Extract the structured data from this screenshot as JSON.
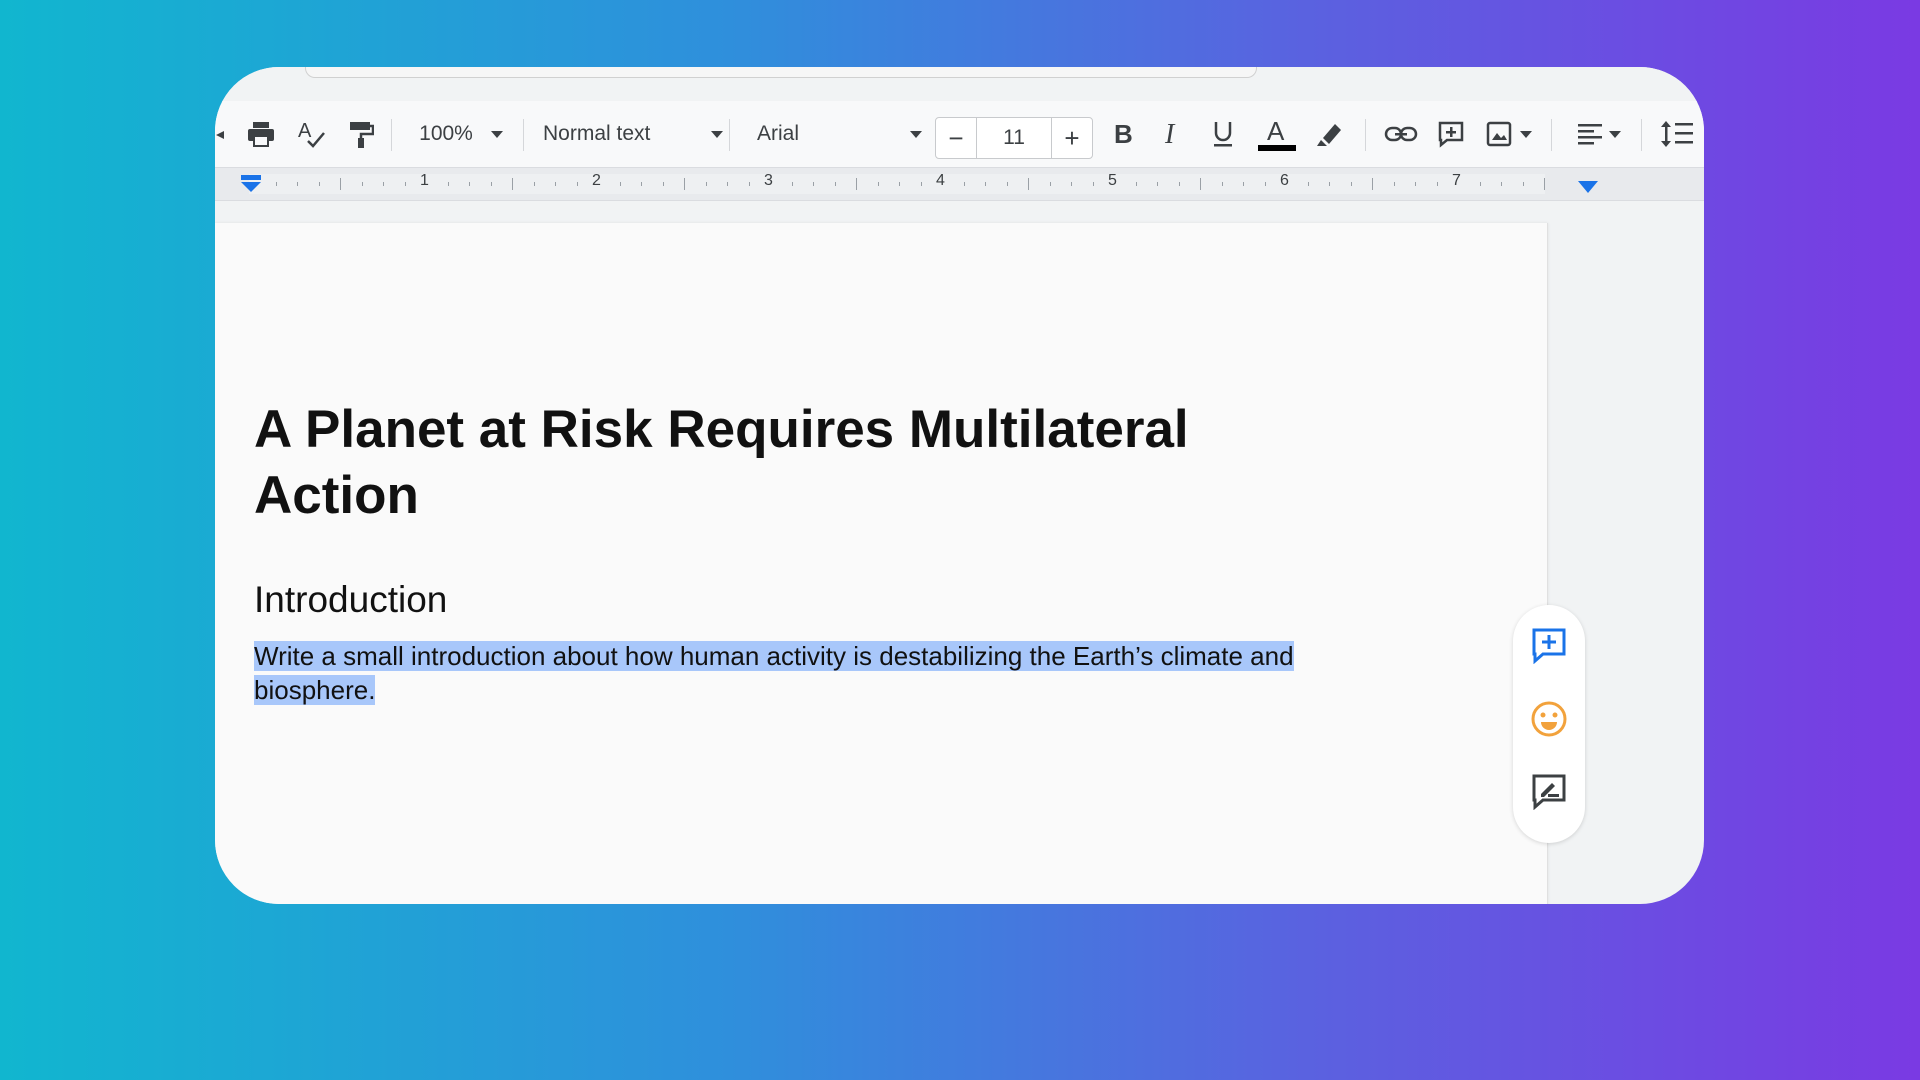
{
  "toolbar": {
    "zoom": "100%",
    "style": "Normal text",
    "font": "Arial",
    "font_size": "11",
    "minus_label": "−",
    "plus_label": "+"
  },
  "ruler": {
    "numbers": [
      "1",
      "2",
      "3",
      "4",
      "5",
      "6",
      "7"
    ]
  },
  "document": {
    "title": "A Planet at Risk Requires Multilateral Action",
    "heading": "Introduction",
    "body": "Write a small introduction about how human activity is destabilizing the Earth’s climate and biosphere."
  },
  "colors": {
    "selection": "#a8c7fa",
    "accent": "#1a73e8",
    "emoji": "#f2a23c",
    "text_color_bar": "#000000"
  },
  "icons": [
    "print-icon",
    "spellcheck-icon",
    "paint-format-icon",
    "bold-icon",
    "italic-icon",
    "underline-icon",
    "text-color-icon",
    "highlight-icon",
    "link-icon",
    "add-comment-icon",
    "insert-image-icon",
    "align-icon",
    "line-spacing-icon",
    "add-comment-side-icon",
    "emoji-reaction-icon",
    "suggest-edits-icon"
  ]
}
